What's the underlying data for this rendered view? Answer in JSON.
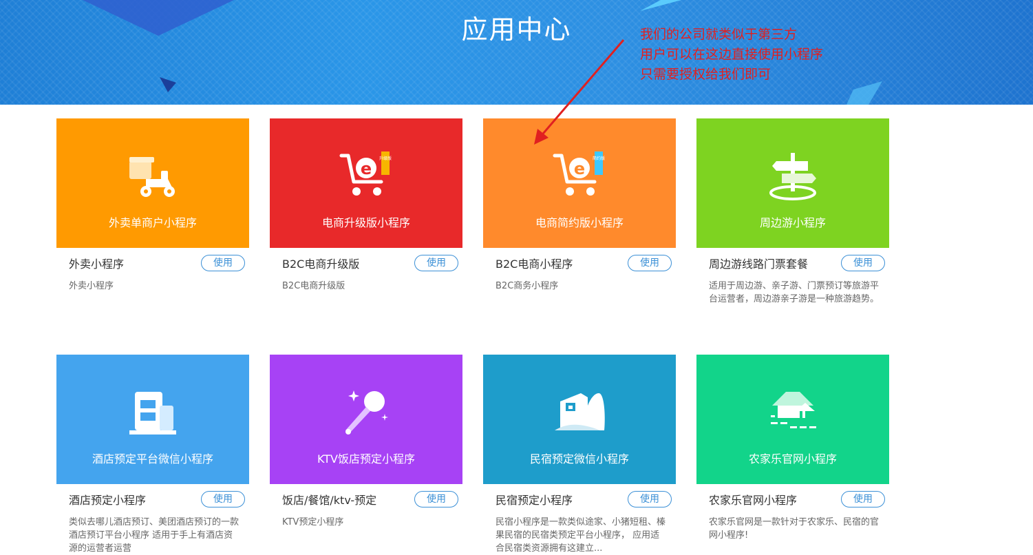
{
  "banner": {
    "title": "应用中心",
    "note_lines": [
      "我们的公司就类似于第三方",
      "用户可以在这边直接使用小程序",
      "只需要授权给我们即可"
    ]
  },
  "colors": {
    "orange": "#FF9A01",
    "red": "#E8292A",
    "orange2": "#FF8A2C",
    "green": "#7ED321",
    "blue": "#44A4EE",
    "purple": "#A742F5",
    "teal": "#1E9DCB",
    "emerald": "#12D48A",
    "button": "#3A8FD6",
    "annotation": "#E02020"
  },
  "use_label": "使用",
  "cards": [
    {
      "tile_label": "外卖单商户小程序",
      "name": "外卖小程序",
      "desc": "外卖小程序",
      "icon": "scooter-icon"
    },
    {
      "tile_label": "电商升级版小程序",
      "name": "B2C电商升级版",
      "desc": "B2C电商升级版",
      "icon": "cart-upgrade-icon",
      "ribbon": "升级版"
    },
    {
      "tile_label": "电商简约版小程序",
      "name": "B2C电商小程序",
      "desc": "B2C商务小程序",
      "icon": "cart-simple-icon",
      "ribbon": "简约版"
    },
    {
      "tile_label": "周边游小程序",
      "name": "周边游线路门票套餐",
      "desc": "适用于周边游、亲子游、门票预订等旅游平台运营者，周边游亲子游是一种旅游趋势。",
      "icon": "signpost-icon"
    },
    {
      "tile_label": "酒店预定平台微信小程序",
      "name": "酒店预定小程序",
      "desc": "类似去哪儿酒店预订、美团酒店预订的一款酒店预订平台小程序 适用于手上有酒店资源的运营者运营",
      "icon": "hotel-icon"
    },
    {
      "tile_label": "KTV饭店预定小程序",
      "name": "饭店/餐馆/ktv-预定",
      "desc": "KTV预定小程序",
      "icon": "microphone-icon"
    },
    {
      "tile_label": "民宿预定微信小程序",
      "name": "民宿预定小程序",
      "desc": "民宿小程序是一款类似途家、小猪短租、榛果民宿的民宿类预定平台小程序， 应用适合民宿类资源拥有这建立...",
      "icon": "homestay-icon"
    },
    {
      "tile_label": "农家乐官网小程序",
      "name": "农家乐官网小程序",
      "desc": "农家乐官网是一款针对于农家乐、民宿的官网小程序!",
      "icon": "farmhouse-icon"
    }
  ]
}
